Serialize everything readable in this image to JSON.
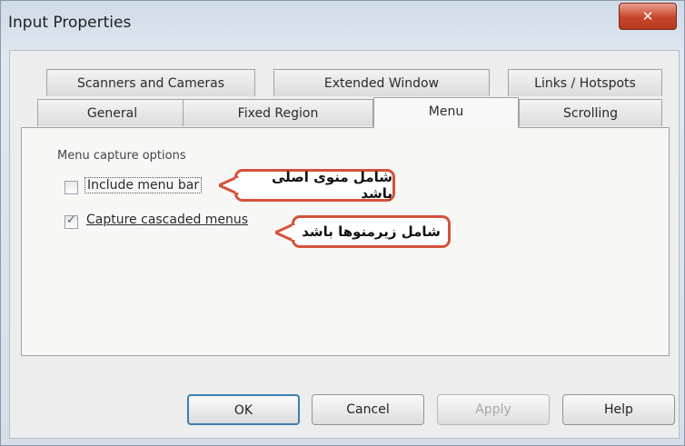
{
  "window": {
    "title": "Input Properties",
    "close_glyph": "✕"
  },
  "tabs": {
    "row_back": [
      "Scanners and Cameras",
      "Extended Window",
      "Links / Hotspots"
    ],
    "row_front": [
      "General",
      "Fixed Region",
      "Menu",
      "Scrolling"
    ],
    "active": "Menu"
  },
  "menu_panel": {
    "group_label": "Menu capture options",
    "options": [
      {
        "label": "Include menu bar",
        "checked": false
      },
      {
        "label": "Capture cascaded menus",
        "checked": true
      }
    ]
  },
  "annotations": [
    "شامل منوی اصلی باشد",
    "شامل زیرمنوها باشد"
  ],
  "buttons": {
    "ok": "OK",
    "cancel": "Cancel",
    "apply": "Apply",
    "help": "Help"
  },
  "colors": {
    "callout_border": "#d3523b",
    "close_button": "#c8442a",
    "default_button_border": "#3c7fb1"
  },
  "icons": {
    "check": "✓"
  }
}
